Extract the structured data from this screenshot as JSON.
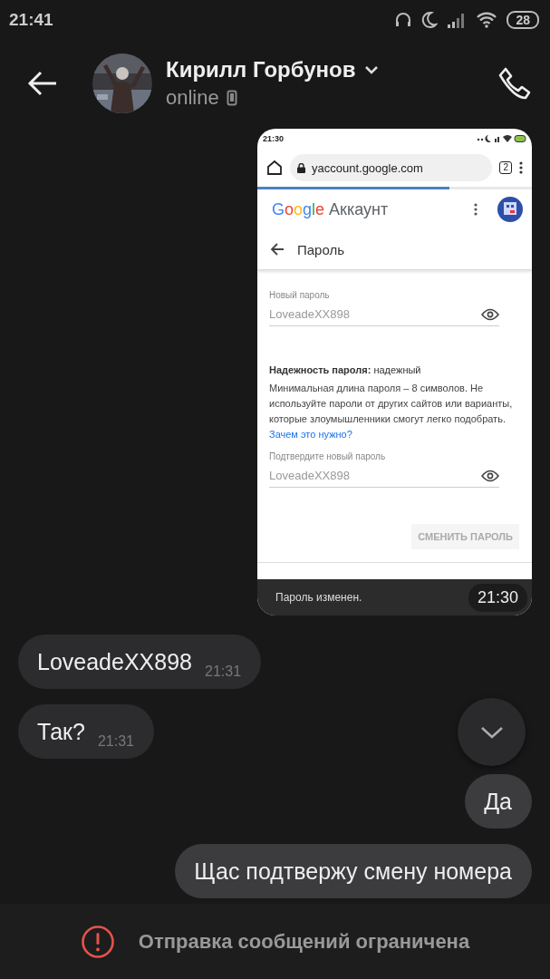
{
  "status_bar": {
    "time": "21:41",
    "battery": "28"
  },
  "header": {
    "name": "Кирилл Горбунов",
    "status": "online"
  },
  "messages": [
    {
      "kind": "screenshot",
      "outgoing": true,
      "caption": "Пароль изменен.",
      "time": "21:30",
      "screenshot": {
        "status_time": "21:30",
        "url": "yaccount.google.com",
        "tab_count": "2",
        "progress": {
          "level": 0.7
        },
        "brand": "Google",
        "app_name": "Аккаунт",
        "page_title": "Пароль",
        "fields": [
          {
            "label": "Новый пароль",
            "value": "LoveadeXX898"
          },
          {
            "label": "Подтвердите новый пароль",
            "value": "LoveadeXX898"
          }
        ],
        "strength": "**Надежность пароля:** надежный",
        "advice": "Минимальная длина пароля – 8 символов. Не используйте пароли от других сайтов или варианты, которые злоумышленники смогут легко подобрать.",
        "advice_link": "Зачем это нужно?",
        "button": {
          "label": "СМЕНИТЬ ПАРОЛЬ",
          "disabled": true
        }
      }
    },
    {
      "kind": "text",
      "outgoing": false,
      "text": "LoveadeXX898",
      "time": "21:31"
    },
    {
      "kind": "text",
      "outgoing": false,
      "text": "Так?",
      "time": "21:31"
    },
    {
      "kind": "text",
      "outgoing": true,
      "text": "Да"
    },
    {
      "kind": "text",
      "outgoing": true,
      "text": "Щас подтвержу смену номера"
    }
  ],
  "footer": {
    "notice": "Отправка сообщений ограничена"
  }
}
